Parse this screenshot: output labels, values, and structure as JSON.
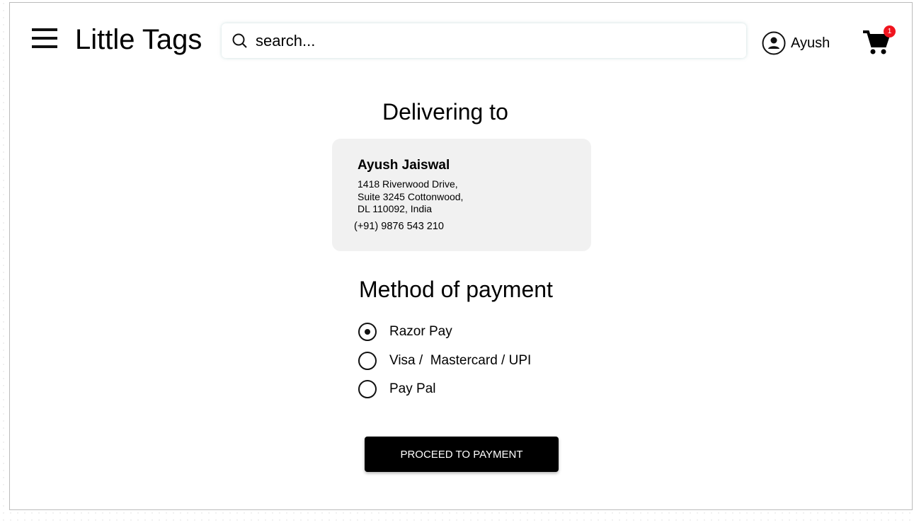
{
  "header": {
    "title": "Little Tags",
    "search_placeholder": "search...",
    "user_name": "Ayush",
    "cart_count": "1"
  },
  "delivery": {
    "heading": "Delivering to",
    "name": "Ayush Jaiswal",
    "address_lines": [
      "1418 Riverwood Drive,",
      "Suite 3245 Cottonwood,",
      "DL 110092, India"
    ],
    "phone": "(+91) 9876 543 210"
  },
  "payment": {
    "heading": "Method of payment",
    "options": [
      {
        "label": "Razor Pay",
        "selected": true
      },
      {
        "label": "Visa /  Mastercard / UPI",
        "selected": false
      },
      {
        "label": "Pay Pal",
        "selected": false
      }
    ],
    "proceed_label": "PROCEED TO PAYMENT"
  }
}
